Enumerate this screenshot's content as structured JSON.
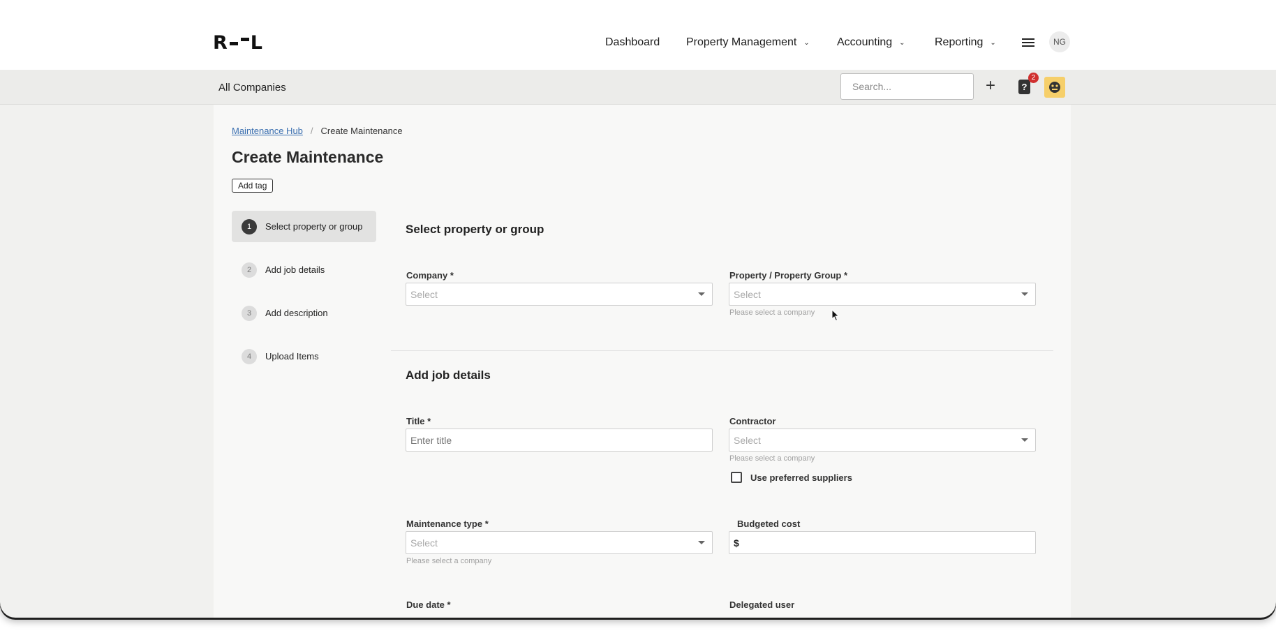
{
  "logo": {
    "left": "R",
    "right": "L"
  },
  "nav": {
    "links": [
      {
        "label": "Dashboard",
        "dropdown": false
      },
      {
        "label": "Property Management",
        "dropdown": true
      },
      {
        "label": "Accounting",
        "dropdown": true
      },
      {
        "label": "Reporting",
        "dropdown": true
      }
    ],
    "user_initials": "NG"
  },
  "subbar": {
    "context": "All Companies",
    "search_placeholder": "Search...",
    "notification_count": "2",
    "help_glyph": "?"
  },
  "breadcrumb": {
    "parent": "Maintenance Hub",
    "separator": "/",
    "current": "Create Maintenance"
  },
  "page": {
    "title": "Create Maintenance",
    "add_tag_label": "Add tag"
  },
  "steps": [
    {
      "num": "1",
      "label": "Select property or group",
      "active": true
    },
    {
      "num": "2",
      "label": "Add job details",
      "active": false
    },
    {
      "num": "3",
      "label": "Add description",
      "active": false
    },
    {
      "num": "4",
      "label": "Upload Items",
      "active": false
    }
  ],
  "section_property": {
    "title": "Select property or group",
    "company": {
      "label": "Company *",
      "value": "Select"
    },
    "property": {
      "label": "Property / Property Group *",
      "value": "Select",
      "hint": "Please select a company"
    }
  },
  "section_job": {
    "title": "Add job details",
    "title_field": {
      "label": "Title *",
      "placeholder": "Enter title"
    },
    "contractor": {
      "label": "Contractor",
      "value": "Select",
      "hint": "Please select a company"
    },
    "preferred": {
      "label": "Use preferred suppliers",
      "checked": false
    },
    "maintenance_type": {
      "label": "Maintenance type *",
      "value": "Select",
      "hint": "Please select a company"
    },
    "budget": {
      "label": "Budgeted cost",
      "prefix": "$"
    },
    "due_date": {
      "label": "Due date *"
    },
    "delegated": {
      "label": "Delegated user"
    }
  },
  "colors": {
    "accent_link": "#3b6fb0",
    "badge": "#d0302f",
    "avatar_bg": "#f6cf6a"
  }
}
